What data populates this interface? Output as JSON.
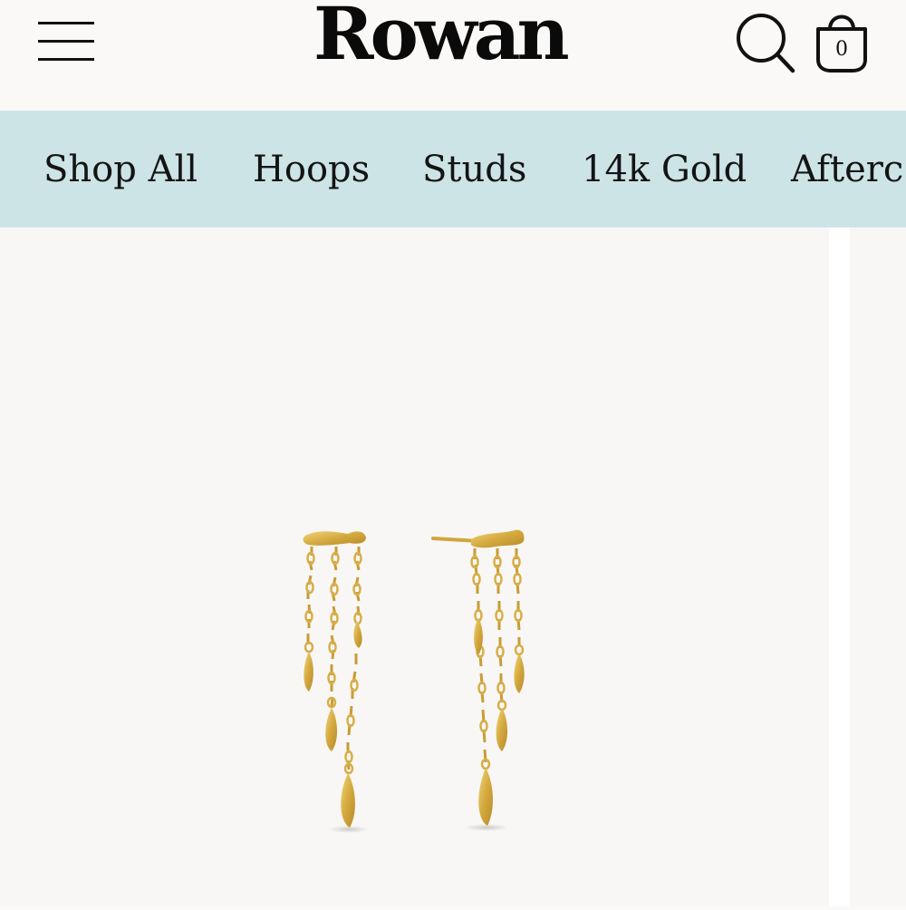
{
  "header": {
    "brand": "Rowan",
    "cart_count": "0",
    "icons": {
      "menu": "hamburger-menu-icon",
      "search": "search-icon",
      "cart": "shopping-bag-icon"
    }
  },
  "nav": {
    "items": [
      {
        "label": "Shop All"
      },
      {
        "label": "Hoops"
      },
      {
        "label": "Studs"
      },
      {
        "label": "14k Gold"
      },
      {
        "label": "Afterc"
      }
    ]
  },
  "product": {
    "image_subject": "gold-drip-chain-drop-earrings"
  },
  "colors": {
    "background": "#faf9f7",
    "nav_background": "#cde4e7",
    "text": "#111111",
    "gold": "#d9b24a"
  }
}
